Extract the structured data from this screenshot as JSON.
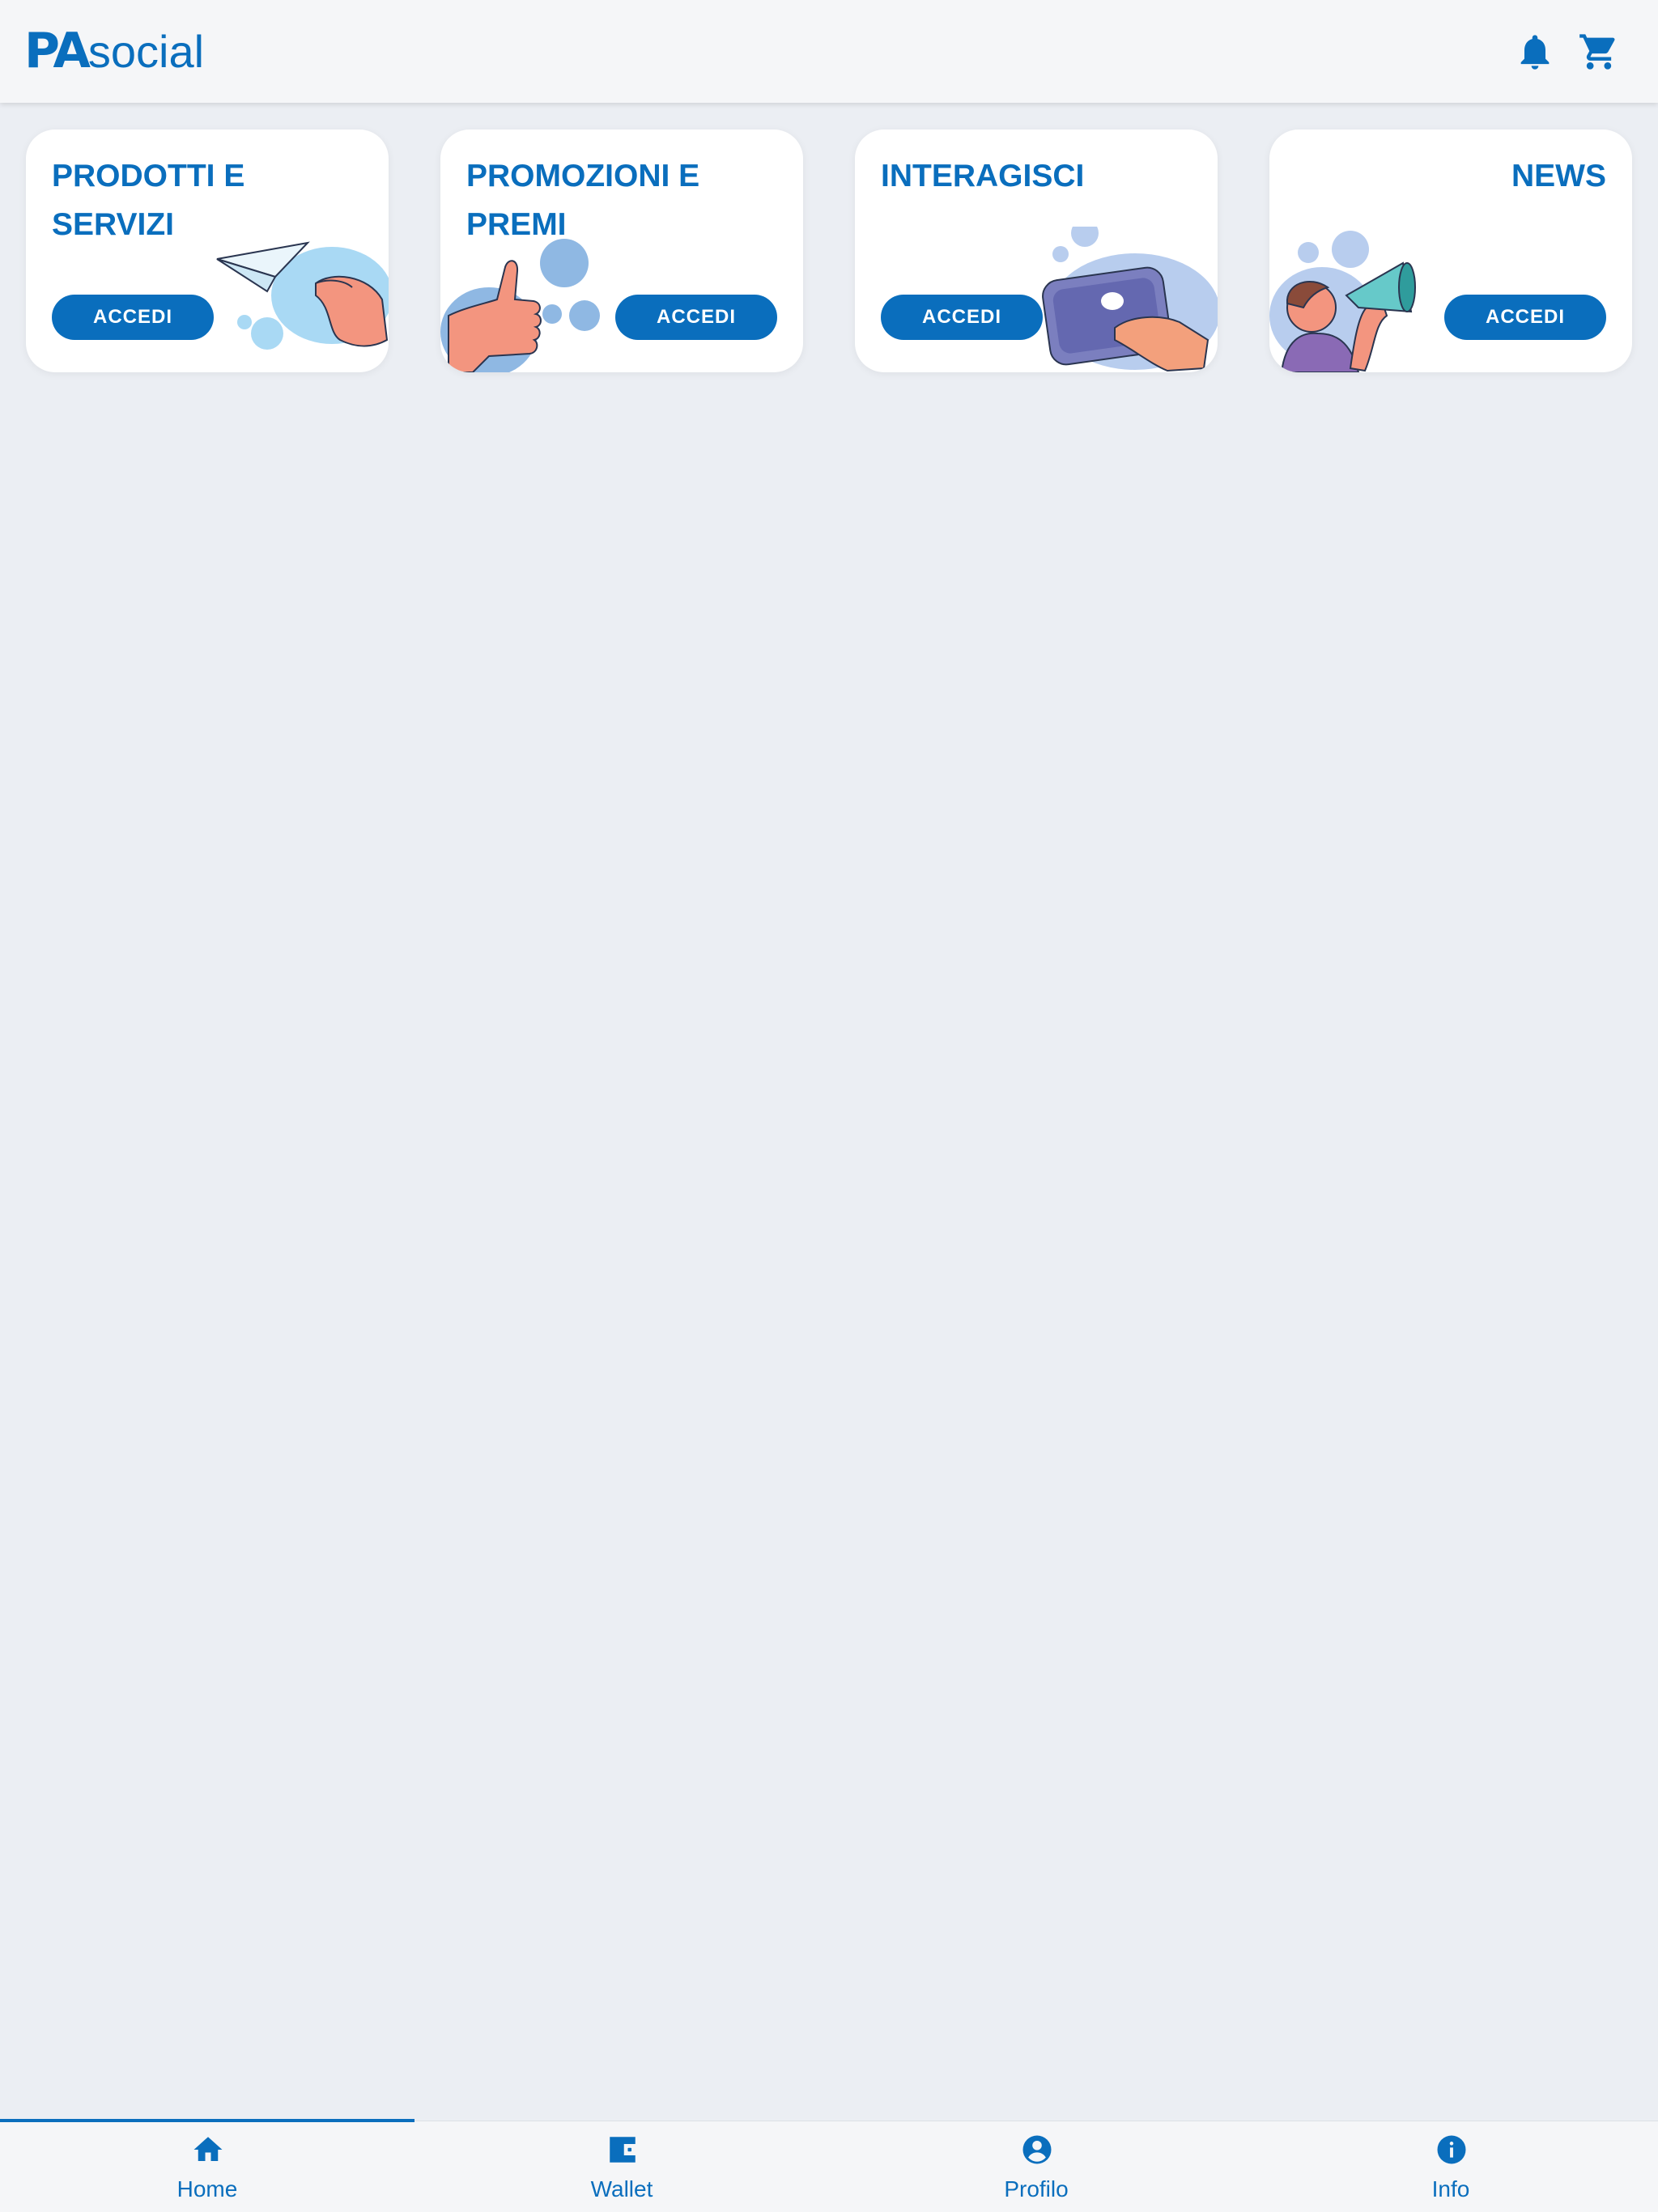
{
  "app": {
    "logo_pa": "PA",
    "logo_social": "social"
  },
  "header": {
    "icons": [
      "bell-icon",
      "cart-icon"
    ]
  },
  "cards": [
    {
      "title": "PRODOTTI E SERVIZI",
      "button": "ACCEDI"
    },
    {
      "title": "PROMOZIONI E PREMI",
      "button": "ACCEDI"
    },
    {
      "title": "INTERAGISCI",
      "button": "ACCEDI"
    },
    {
      "title": "NEWS",
      "button": "ACCEDI"
    }
  ],
  "nav": {
    "active": "Home",
    "items": [
      {
        "label": "Home",
        "icon": "home-icon"
      },
      {
        "label": "Wallet",
        "icon": "wallet-icon"
      },
      {
        "label": "Profilo",
        "icon": "profile-icon"
      },
      {
        "label": "Info",
        "icon": "info-icon"
      }
    ]
  },
  "colors": {
    "primary": "#0a6ebd",
    "background": "#ebeef3",
    "surface": "#ffffff"
  }
}
